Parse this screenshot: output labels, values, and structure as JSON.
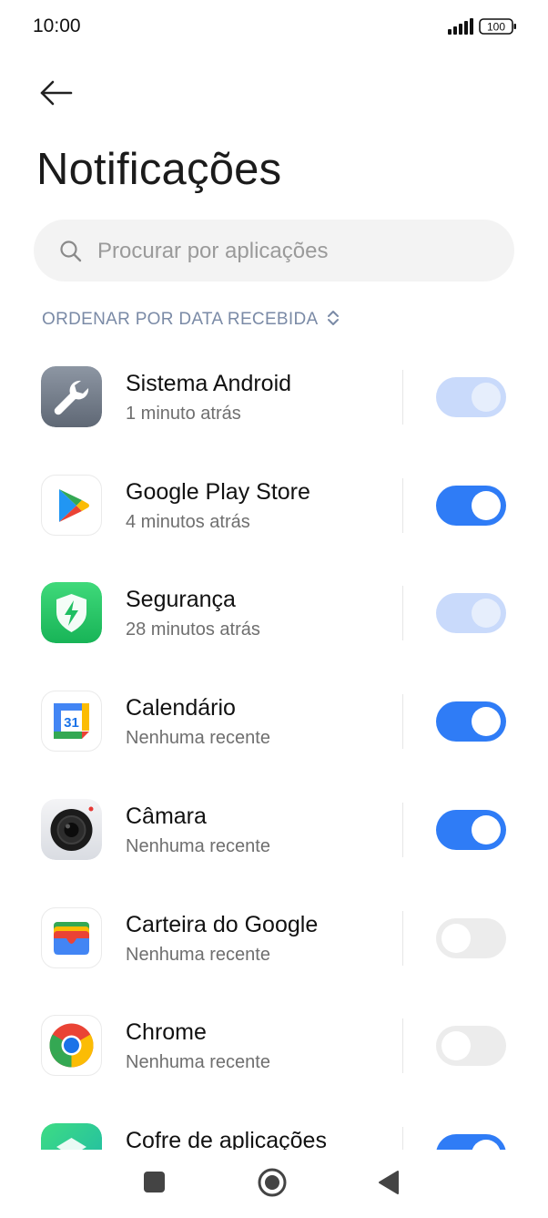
{
  "status_bar": {
    "time": "10:00",
    "battery": "100",
    "icons": [
      "signal-icon",
      "battery-icon"
    ]
  },
  "header": {
    "back_icon": "arrow-left-icon",
    "title": "Notificações"
  },
  "search": {
    "placeholder": "Procurar por aplicações",
    "value": "",
    "icon": "search-icon"
  },
  "sort": {
    "label": "ORDENAR POR DATA RECEBIDA",
    "icon": "chevron-updown-icon"
  },
  "apps": [
    {
      "name": "Sistema Android",
      "subtitle": "1 minuto atrás",
      "toggle": "on-disabled",
      "icon": "wrench-settings-icon"
    },
    {
      "name": "Google Play Store",
      "subtitle": "4 minutos atrás",
      "toggle": "on",
      "icon": "google-play-icon"
    },
    {
      "name": "Segurança",
      "subtitle": "28 minutos atrás",
      "toggle": "on-disabled",
      "icon": "security-shield-icon"
    },
    {
      "name": "Calendário",
      "subtitle": "Nenhuma recente",
      "toggle": "on",
      "icon": "google-calendar-icon",
      "icon_text": "31"
    },
    {
      "name": "Câmara",
      "subtitle": "Nenhuma recente",
      "toggle": "on",
      "icon": "camera-icon"
    },
    {
      "name": "Carteira do Google",
      "subtitle": "Nenhuma recente",
      "toggle": "off",
      "icon": "google-wallet-icon"
    },
    {
      "name": "Chrome",
      "subtitle": "Nenhuma recente",
      "toggle": "off",
      "icon": "chrome-icon"
    },
    {
      "name": "Cofre de aplicações",
      "subtitle": "",
      "toggle": "on",
      "icon": "app-vault-icon"
    }
  ],
  "nav": {
    "recents_icon": "square-recents-icon",
    "home_icon": "circle-home-icon",
    "back_icon": "triangle-back-icon"
  },
  "colors": {
    "accent": "#2f7cf6",
    "accent_disabled": "#c9dafb",
    "toggle_off": "#ececec",
    "sort_label": "#7a8aa6"
  }
}
